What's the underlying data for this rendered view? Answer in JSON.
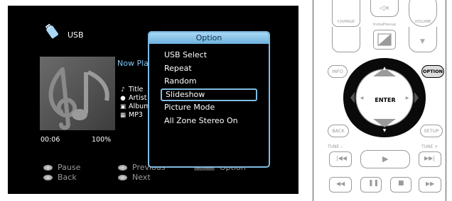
{
  "screen": {
    "source": {
      "icon": "usb-stick-icon",
      "label": "USB"
    },
    "now_playing": "Now Playing",
    "meta": [
      {
        "icon": "music-note-icon",
        "label": "Title"
      },
      {
        "icon": "person-icon",
        "label": "Artist"
      },
      {
        "icon": "album-icon",
        "label": "Album"
      },
      {
        "icon": "file-format-icon",
        "label": "MP3"
      }
    ],
    "time": "00:06",
    "progress": "100%",
    "hints": {
      "pause": "Pause",
      "back": "Back",
      "previous": "Previous",
      "next": "Next",
      "option_badge": "OPTION",
      "option": "Option"
    }
  },
  "option_menu": {
    "title": "Option",
    "items": [
      "USB Select",
      "Repeat",
      "Random",
      "Slideshow",
      "Picture Mode",
      "All Zone Stereo On"
    ],
    "selected_index": 3
  },
  "remote": {
    "ch_page": "CH/PAGE",
    "instaprevue": "InstaPrevue",
    "volume": "VOLUME",
    "info": "INFO",
    "option": "OPTION",
    "enter": "ENTER",
    "back": "BACK",
    "setup": "SETUP",
    "tune_minus": "TUNE –",
    "tune_plus": "TUNE +"
  },
  "colors": {
    "accent": "#7fbbe2",
    "now_playing": "#7fc7f3",
    "screen_bg": "#000000",
    "remote_outline": "#9a9a9a"
  }
}
